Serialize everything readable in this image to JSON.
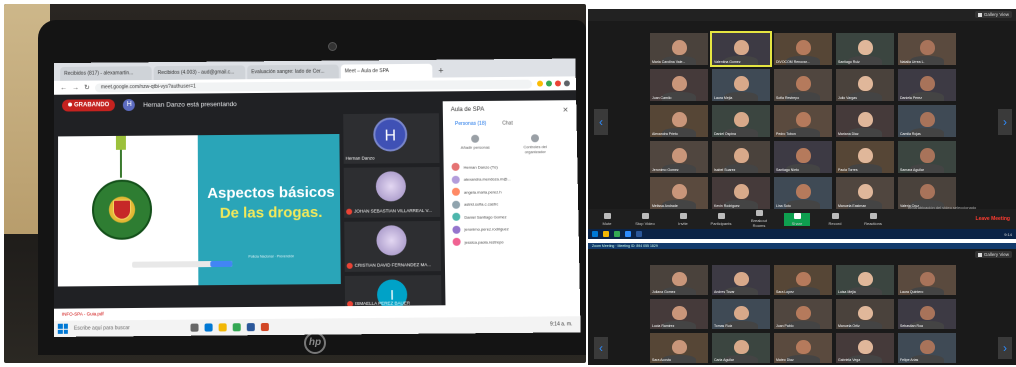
{
  "left_photo": {
    "browser_tabs": [
      "Recibidos (817) - alexamartin...",
      "Recibidos (4.003) - aud@gmail.c...",
      "Evaluación sangre: lado de Cer...",
      "Meet – Aula de SPA"
    ],
    "new_tab_symbol": "+",
    "url": "meet.google.com/nzw-qtbi-vys?authuser=1",
    "recording_label": "GRABANDO",
    "presenter_initial": "H",
    "presenting_text": "Hernan Danzo está presentando",
    "slide": {
      "title_line1": "Aspectos básicos",
      "title_line2": "De las drogas.",
      "small_text": "Policía Nacional · Prevención"
    },
    "tiles": [
      {
        "initial": "H",
        "name": "Hernan Danzo"
      },
      {
        "initial": "",
        "name": "JOHAN SEBASTIAN VILLARREAL V..."
      },
      {
        "initial": "",
        "name": "CRISTIAN DAVID FERNANDEZ MA..."
      },
      {
        "initial": "I",
        "name": "ISMAELLA PEREZ BAUER"
      }
    ],
    "panel": {
      "title": "Aula de SPA",
      "close": "✕",
      "tab_people": "Personas (18)",
      "tab_chat": "Chat",
      "action_add": "Añadir personas",
      "action_organizer": "Controles del organizador",
      "people": [
        "Hernan Danzo (Tú)",
        "alexandra.mendoza.m@...",
        "angela.maria.perez.h",
        "astrid.sofia.c.castro",
        "Daniel Santiago Gomez",
        "jeronimo.perez.rodriguez",
        "jessica.paola.restrepo"
      ]
    },
    "file_bar_text": "INFO-SPA - Guia.pdf",
    "taskbar_search": "Escribe aquí para buscar",
    "taskbar_time": "9:14 a. m."
  },
  "zoom_top": {
    "gallery_view": "Gallery View",
    "arrow_left": "‹",
    "arrow_right": "›",
    "names": [
      "Maria Carolina Vale...",
      "Valentina Gomez",
      "DIVOCOM Renovar...",
      "Santiago Ruiz",
      "Natalia Urrea L.",
      "Juan Camilo",
      "Laura Mejia",
      "Sofia Restrepo",
      "Julio Vargas",
      "Daniela Perez",
      "Alexandra Prieto",
      "Daniel Ospina",
      "Pedro Tobon",
      "Mariana Diaz",
      "Camila Rojas",
      "Jeronimo Gomez",
      "Isabel Suarez",
      "Santiago Nieto",
      "Paola Torres",
      "Samara Aguilar",
      "Melissa Andrade",
      "Kevin Rodriguez",
      "Lina Soto",
      "Manuela Eastman",
      "Valeria Cruz"
    ],
    "toolbar": [
      "Mute",
      "Stop Video",
      "Invite",
      "Participants",
      "Breakout Rooms",
      "Share",
      "Record",
      "Reactions"
    ],
    "end_label": "Leave Meeting",
    "caption": "en la ubicación del video seleccionado",
    "taskbar_time": "9:14"
  },
  "zoom_bottom": {
    "title_bar": "Zoom Meeting · Meeting ID: 894 055 1829",
    "gallery_view": "Gallery View",
    "arrow_left": "‹",
    "arrow_right": "›",
    "names": [
      "Juliana Gomez",
      "Andres Tovar",
      "Sara Lopez",
      "Luisa Mejia",
      "Laura Quintero",
      "Lucia Ramirez",
      "Tomas Ruiz",
      "Juan Pablo",
      "Manuela Ortiz",
      "Sebastian Roa",
      "Sara Acosta",
      "Carla Aguilar",
      "Mateo Diaz",
      "Gabriela Vega",
      "Felipe Arias"
    ]
  }
}
